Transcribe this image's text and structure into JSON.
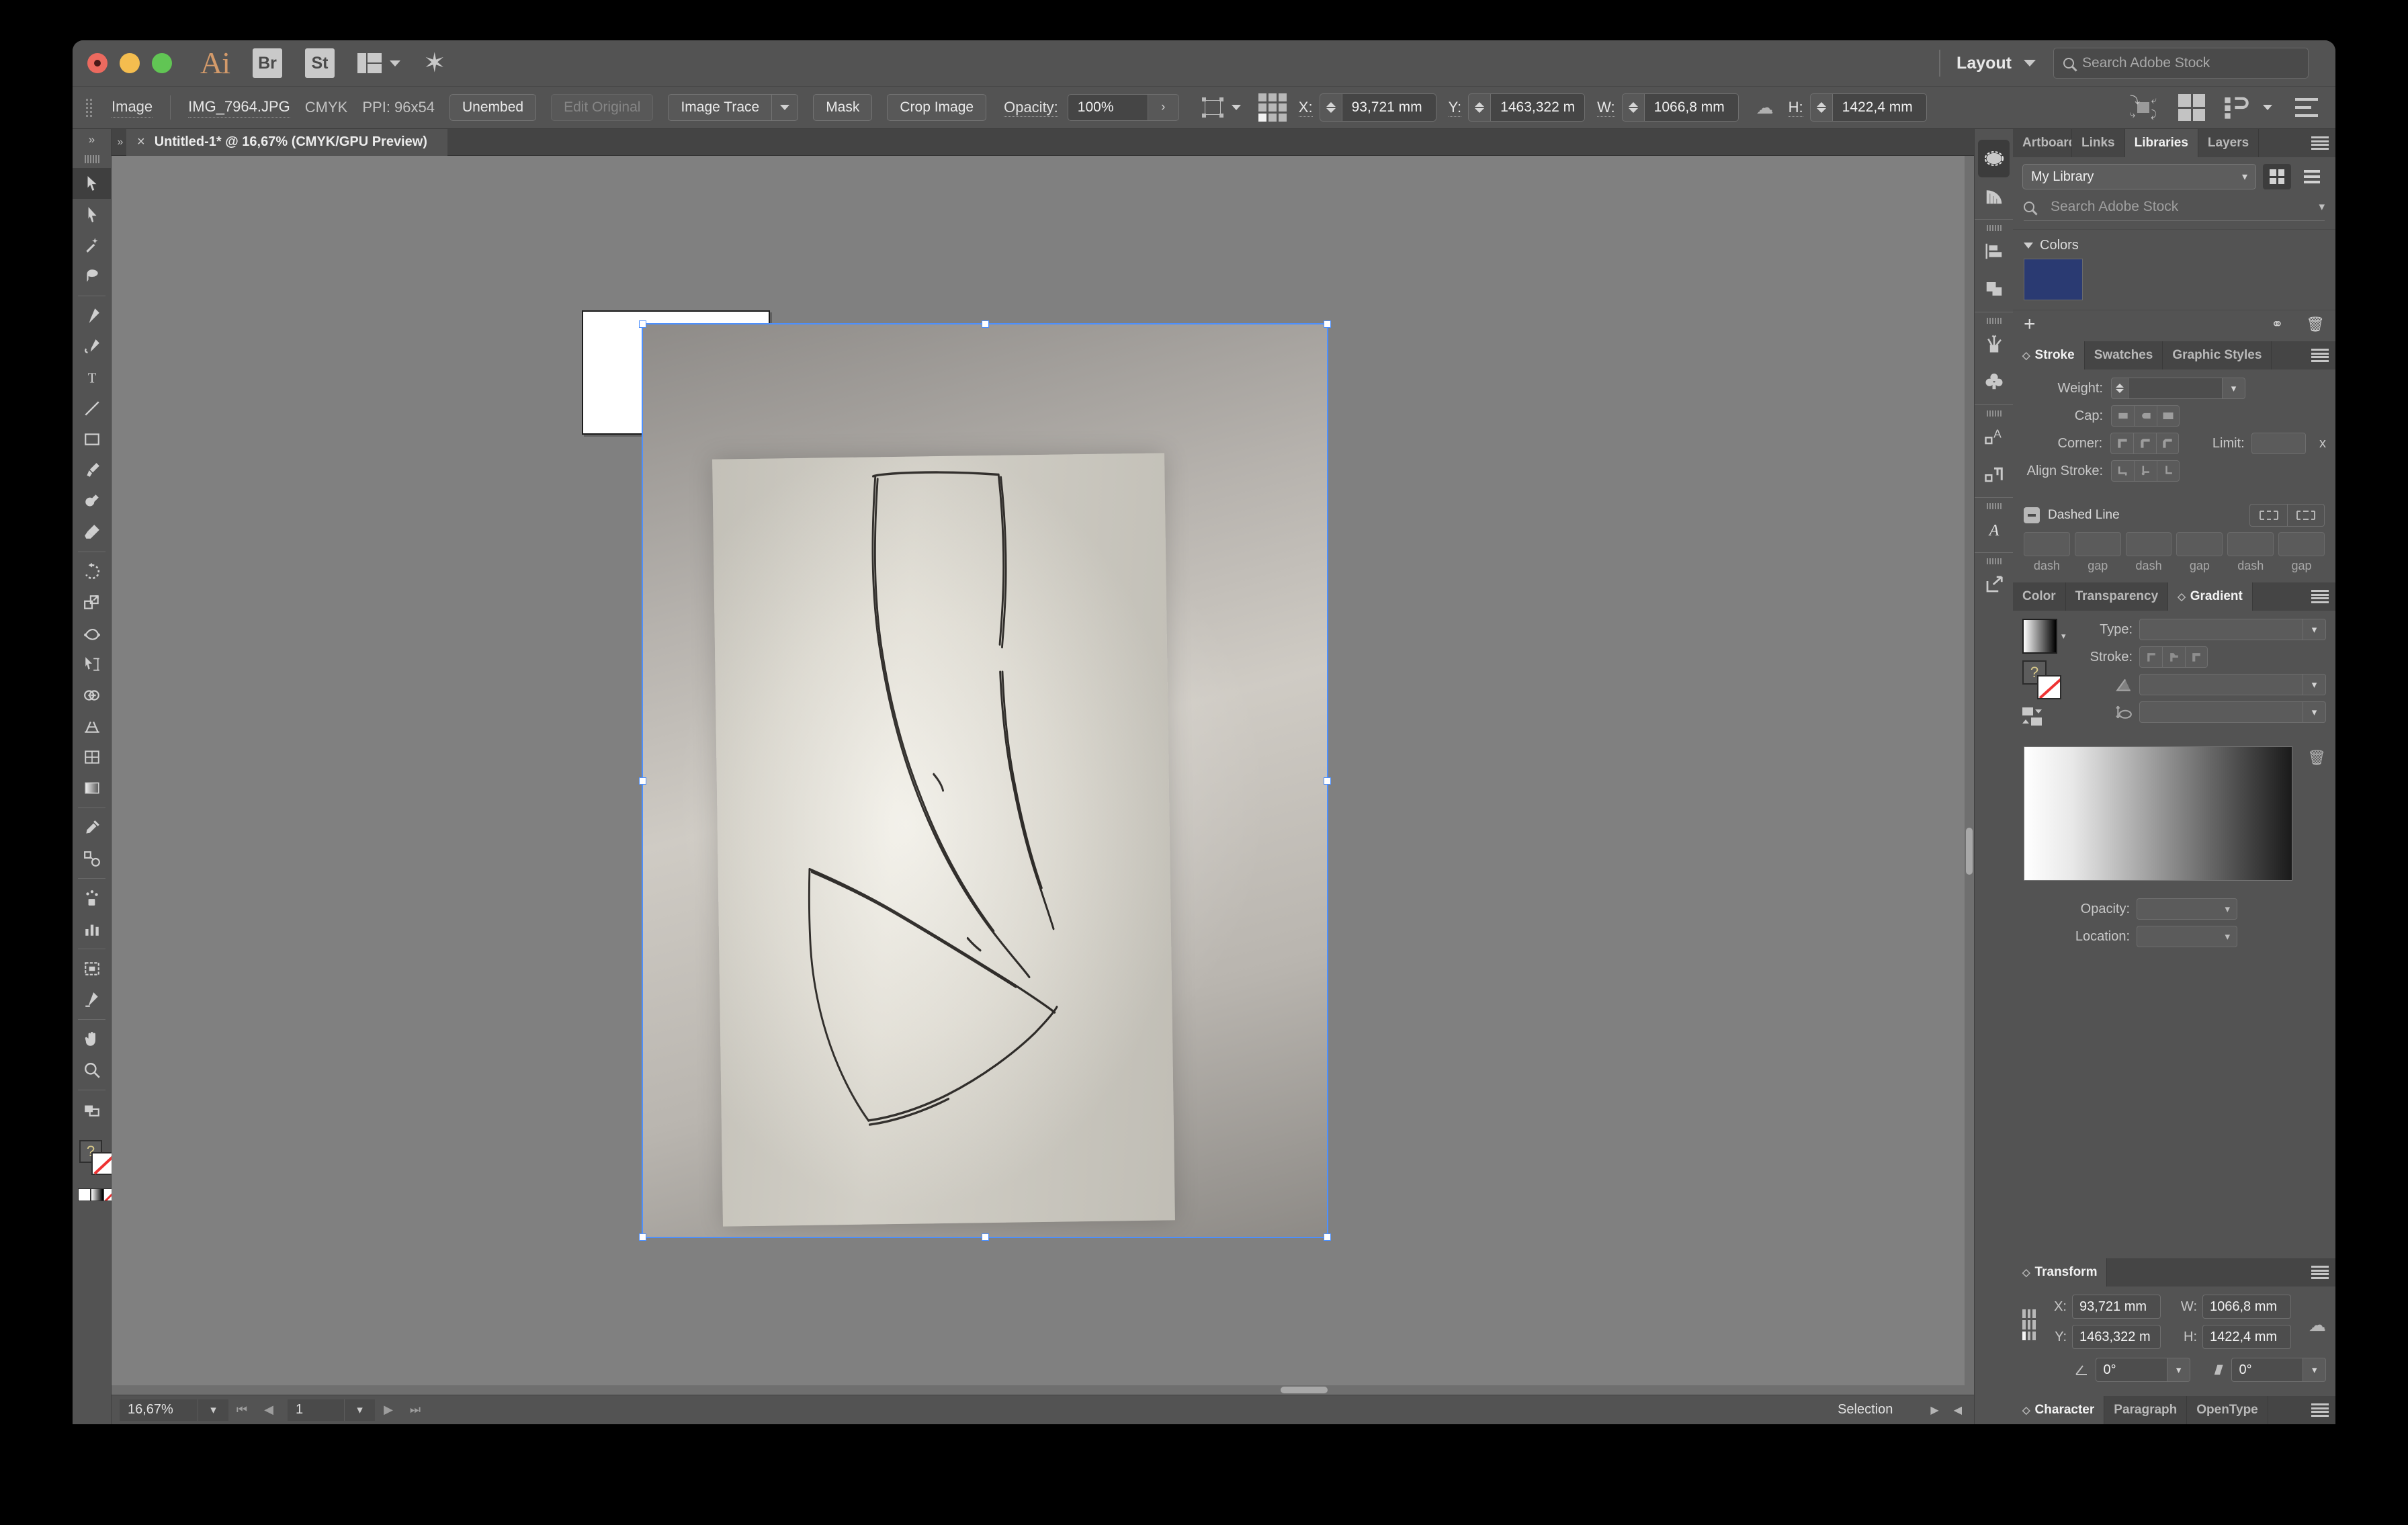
{
  "window": {
    "app_name": "Ai",
    "bridge_label": "Br",
    "stock_label": "St",
    "layout_label": "Layout",
    "search_placeholder": "Search Adobe Stock"
  },
  "control_bar": {
    "type_label": "Image",
    "file_name": "IMG_7964.JPG",
    "color_mode": "CMYK",
    "ppi": "PPI: 96x54",
    "unembed": "Unembed",
    "edit_original": "Edit Original",
    "image_trace": "Image Trace",
    "mask": "Mask",
    "crop_image": "Crop Image",
    "opacity_label": "Opacity:",
    "opacity_value": "100%",
    "x_label": "X:",
    "x_value": "93,721 mm",
    "y_label": "Y:",
    "y_value": "1463,322 m",
    "w_label": "W:",
    "w_value": "1066,8 mm",
    "h_label": "H:",
    "h_value": "1422,4 mm"
  },
  "document": {
    "tab_title": "Untitled-1* @ 16,67% (CMYK/GPU Preview)",
    "close_glyph": "×"
  },
  "status_bar": {
    "zoom": "16,67%",
    "page": "1",
    "tool": "Selection"
  },
  "tools": [
    {
      "name": "selection-tool",
      "label": "Selection"
    },
    {
      "name": "direct-selection-tool",
      "label": "Direct Selection"
    },
    {
      "name": "magic-wand-tool",
      "label": "Magic Wand"
    },
    {
      "name": "lasso-tool",
      "label": "Lasso"
    },
    {
      "name": "pen-tool",
      "label": "Pen"
    },
    {
      "name": "curvature-tool",
      "label": "Curvature"
    },
    {
      "name": "type-tool",
      "label": "Type"
    },
    {
      "name": "line-segment-tool",
      "label": "Line Segment"
    },
    {
      "name": "rectangle-tool",
      "label": "Rectangle"
    },
    {
      "name": "paintbrush-tool",
      "label": "Paintbrush"
    },
    {
      "name": "shaper-tool",
      "label": "Shaper"
    },
    {
      "name": "eraser-tool",
      "label": "Eraser"
    },
    {
      "name": "rotate-tool",
      "label": "Rotate"
    },
    {
      "name": "scale-tool",
      "label": "Scale"
    },
    {
      "name": "width-tool",
      "label": "Width"
    },
    {
      "name": "free-transform-tool",
      "label": "Free Transform"
    },
    {
      "name": "shape-builder-tool",
      "label": "Shape Builder"
    },
    {
      "name": "perspective-grid-tool",
      "label": "Perspective Grid"
    },
    {
      "name": "mesh-tool",
      "label": "Mesh"
    },
    {
      "name": "gradient-tool",
      "label": "Gradient"
    },
    {
      "name": "eyedropper-tool",
      "label": "Eyedropper"
    },
    {
      "name": "blend-tool",
      "label": "Blend"
    },
    {
      "name": "symbol-sprayer-tool",
      "label": "Symbol Sprayer"
    },
    {
      "name": "column-graph-tool",
      "label": "Column Graph"
    },
    {
      "name": "artboard-tool",
      "label": "Artboard"
    },
    {
      "name": "slice-tool",
      "label": "Slice"
    },
    {
      "name": "hand-tool",
      "label": "Hand"
    },
    {
      "name": "zoom-tool",
      "label": "Zoom"
    }
  ],
  "icon_rail": [
    {
      "name": "appearance-icon"
    },
    {
      "name": "gradient-rail-icon"
    },
    {
      "name": "align-icon"
    },
    {
      "name": "pathfinder-icon"
    },
    {
      "name": "brushes-icon"
    },
    {
      "name": "symbols-icon"
    },
    {
      "name": "type-wrap-icon"
    },
    {
      "name": "paragraph-styles-icon"
    },
    {
      "name": "glyphs-icon"
    },
    {
      "name": "asset-export-icon"
    }
  ],
  "libraries_panel": {
    "tabs": [
      {
        "label": "Artboards",
        "active": false
      },
      {
        "label": "Links",
        "active": false
      },
      {
        "label": "Libraries",
        "active": true
      },
      {
        "label": "Layers",
        "active": false
      }
    ],
    "library_select": "My Library",
    "search_placeholder": "Search Adobe Stock",
    "colors_section": "Colors",
    "color_swatch_hex": "#2a3a72"
  },
  "stroke_panel": {
    "tabs": [
      {
        "label": "Stroke",
        "active": true
      },
      {
        "label": "Swatches",
        "active": false
      },
      {
        "label": "Graphic Styles",
        "active": false
      }
    ],
    "weight_label": "Weight:",
    "weight_value": "",
    "cap_label": "Cap:",
    "corner_label": "Corner:",
    "limit_label": "Limit:",
    "limit_value": "",
    "limit_unit": "x",
    "align_stroke_label": "Align Stroke:",
    "dashed_line_label": "Dashed Line",
    "dash_fields": [
      {
        "label": "dash",
        "value": ""
      },
      {
        "label": "gap",
        "value": ""
      },
      {
        "label": "dash",
        "value": ""
      },
      {
        "label": "gap",
        "value": ""
      },
      {
        "label": "dash",
        "value": ""
      },
      {
        "label": "gap",
        "value": ""
      }
    ]
  },
  "gradient_panel": {
    "tabs": [
      {
        "label": "Color",
        "active": false
      },
      {
        "label": "Transparency",
        "active": false
      },
      {
        "label": "Gradient",
        "active": true
      }
    ],
    "type_label": "Type:",
    "type_value": "",
    "stroke_label": "Stroke:",
    "angle_value": "",
    "aspect_value": "",
    "opacity_label": "Opacity:",
    "opacity_value": "",
    "location_label": "Location:",
    "location_value": ""
  },
  "transform_panel": {
    "tabs": [
      {
        "label": "Transform",
        "active": true
      }
    ],
    "x_label": "X:",
    "x_value": "93,721 mm",
    "w_label": "W:",
    "w_value": "1066,8 mm",
    "y_label": "Y:",
    "y_value": "1463,322 m",
    "h_label": "H:",
    "h_value": "1422,4 mm",
    "angle_value": "0°",
    "shear_value": "0°"
  },
  "character_panel": {
    "tabs": [
      {
        "label": "Character",
        "active": true
      },
      {
        "label": "Paragraph",
        "active": false
      },
      {
        "label": "OpenType",
        "active": false
      }
    ]
  }
}
